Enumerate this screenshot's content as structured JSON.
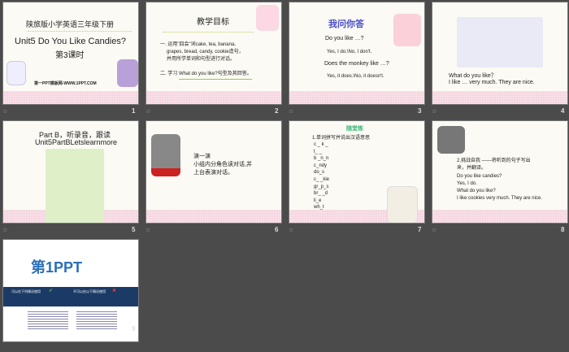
{
  "slides": [
    {
      "number": "1",
      "series": "陕旅版小学英语三年级下册",
      "title": "Unit5  Do You Like Candies?",
      "lesson": "第3课时",
      "site": "第一PPT模板网-WWW.1PPT.COM"
    },
    {
      "number": "2",
      "title": "教学目标",
      "goal1a": "一. 运用\"四会\"词cake, tea, banana,",
      "goal1b": "grapes, bread, candy, cookie造句，",
      "goal1c": "并用所学单词和句型进行对话。",
      "goal2": "二. 学习 What do you like?句型及其回答。"
    },
    {
      "number": "3",
      "title": "我问你答",
      "q1": "Do you like …?",
      "a1": "Yes, I do.\\No, I don't.",
      "q2": "Does the monkey like …?",
      "a2": "Yes, it does.\\No, it doesn't."
    },
    {
      "number": "4",
      "q": "What do you like？",
      "a": "I like … very much. They are nice."
    },
    {
      "number": "5",
      "title1": "Part B，听录音，跟读",
      "title2": "Unit5PartBLetslearnmore"
    },
    {
      "number": "6",
      "l1": "演一演",
      "l2": "小组内分角色读对话,并",
      "l3": "上台表演对话。"
    },
    {
      "number": "7",
      "title": "随堂练",
      "task": "1.单词拼写并说出汉语意思",
      "words": [
        "c _ k _",
        "t_ _",
        "b _n_n",
        "c_ndy",
        "do_s",
        "c_ _kie",
        "gr_p_s",
        "br_ _d",
        "li_e",
        "wh_t"
      ]
    },
    {
      "number": "8",
      "task1": "2.挑战自我 ——将听到的句子写出",
      "task2": "来，并翻译。",
      "lines": [
        "Do you like candies?",
        "Yes, I do.",
        "What do you like?",
        "I like cookies very much. They are nice."
      ]
    },
    {
      "number": "9",
      "logo": "第1PPT",
      "left_head": "可以在下列情况使用",
      "right_head": "不可以在以下情况使用"
    }
  ],
  "colors": {
    "background": "#4b4b4b",
    "band": "#f5d6e0",
    "title3": "#4a4fc8",
    "title7": "#3cb878",
    "navy": "#1b3a66"
  }
}
